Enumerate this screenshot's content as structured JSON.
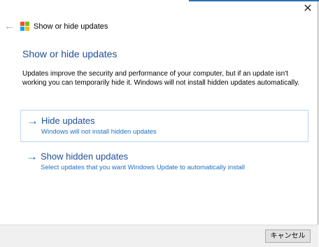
{
  "window": {
    "close_glyph": "✕",
    "back_glyph": "←",
    "title": "Show or hide updates",
    "accent_color": "#2b6fb6"
  },
  "main": {
    "heading": "Show or hide updates",
    "description": "Updates improve the security and performance of your computer, but if an update isn't working you can temporarily hide it. Windows will not install hidden updates automatically."
  },
  "options": [
    {
      "arrow": "→",
      "title": "Hide updates",
      "subtitle": "Windows will not install hidden updates",
      "selected": true
    },
    {
      "arrow": "→",
      "title": "Show hidden updates",
      "subtitle": "Select updates that you want Windows Update to automatically install",
      "selected": false
    }
  ],
  "footer": {
    "cancel_label": "キャンセル"
  },
  "icons": {
    "back": "back-arrow-icon",
    "logo": "windows-logo-icon",
    "close": "close-icon",
    "option_arrow": "arrow-right-icon"
  }
}
